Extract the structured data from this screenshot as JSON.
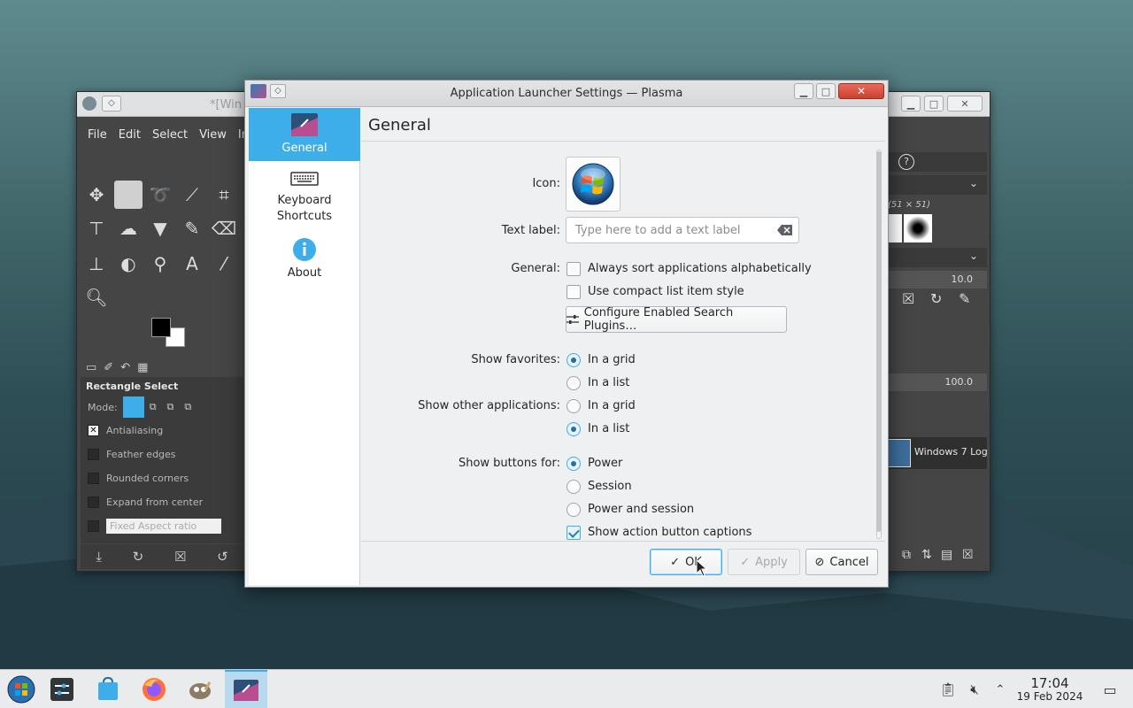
{
  "gimp": {
    "title": "*[Win",
    "menu": [
      "File",
      "Edit",
      "Select",
      "View",
      "Im"
    ],
    "tool_options_title": "Rectangle Select",
    "mode_label": "Mode:",
    "options": [
      {
        "label": "Antialiasing",
        "checked": true
      },
      {
        "label": "Feather edges",
        "checked": false
      },
      {
        "label": "Rounded corners",
        "checked": false
      },
      {
        "label": "Expand from center",
        "checked": false
      },
      {
        "label": "Fixed   Aspect ratio",
        "checked": false
      }
    ],
    "dock": {
      "brush_size": "(51 × 51)",
      "value_1": "10.0",
      "value_2": "100.0",
      "layer_name": "Windows 7 Log"
    }
  },
  "dialog": {
    "title": "Application Launcher Settings — Plasma",
    "sidebar": [
      {
        "label": "General",
        "selected": true
      },
      {
        "label": "Keyboard\nShortcuts",
        "line1": "Keyboard",
        "line2": "Shortcuts",
        "selected": false
      },
      {
        "label": "About",
        "selected": false
      }
    ],
    "page_title": "General",
    "icon_label": "Icon:",
    "text_label": "Text label:",
    "text_placeholder": "Type here to add a text label",
    "text_value": "",
    "general_label": "General:",
    "general_options": [
      {
        "label": "Always sort applications alphabetically",
        "checked": false
      },
      {
        "label": "Use compact list item style",
        "checked": false
      }
    ],
    "configure_button": "Configure Enabled Search Plugins…",
    "show_favorites_label": "Show favorites:",
    "favorites_options": [
      {
        "label": "In a grid",
        "checked": true
      },
      {
        "label": "In a list",
        "checked": false
      }
    ],
    "show_other_label": "Show other applications:",
    "other_options": [
      {
        "label": "In a grid",
        "checked": false
      },
      {
        "label": "In a list",
        "checked": true
      }
    ],
    "show_buttons_label": "Show buttons for:",
    "buttons_options": [
      {
        "label": "Power",
        "checked": true
      },
      {
        "label": "Session",
        "checked": false
      },
      {
        "label": "Power and session",
        "checked": false
      }
    ],
    "captions_option": {
      "label": "Show action button captions",
      "checked": true
    },
    "ok_button": "OK",
    "apply_button": "Apply",
    "cancel_button": "Cancel"
  },
  "taskbar": {
    "time": "17:04",
    "date": "19 Feb 2024"
  },
  "colors": {
    "accent": "#3daee9",
    "close_red": "#d9503f"
  }
}
